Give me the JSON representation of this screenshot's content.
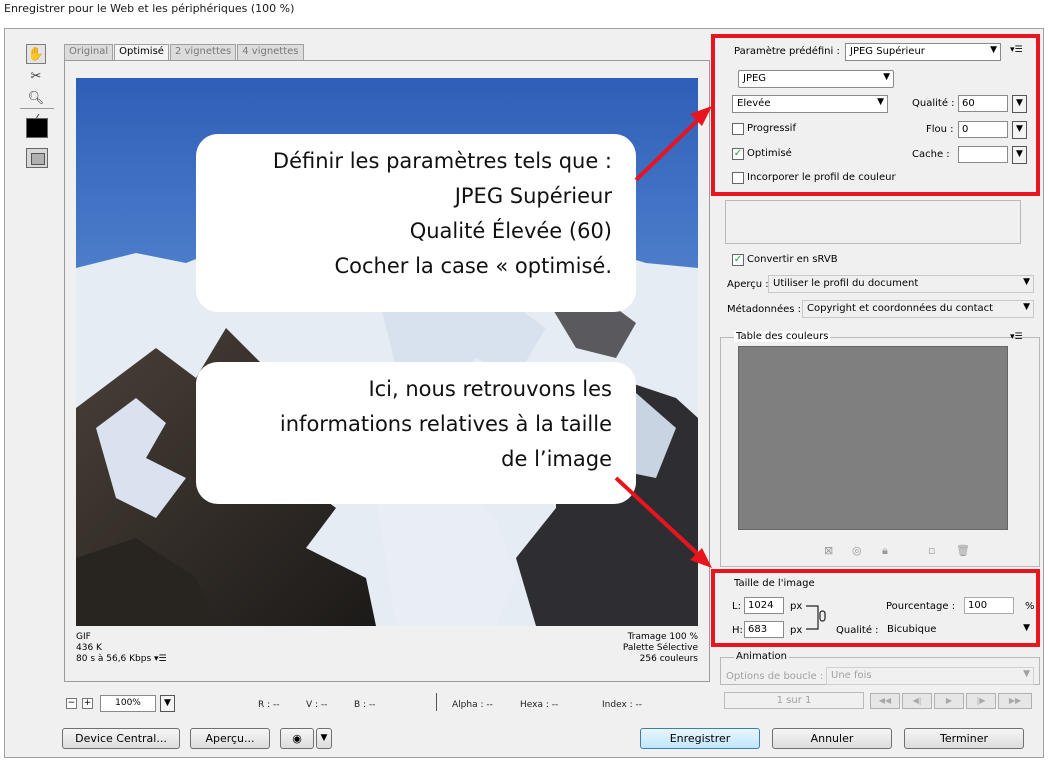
{
  "window": {
    "title": "Enregistrer pour le Web et les périphériques (100 %)"
  },
  "tabs": [
    "Original",
    "Optimisé",
    "2 vignettes",
    "4 vignettes"
  ],
  "active_tab": "Optimisé",
  "preview_info": {
    "format": "GIF",
    "size": "436 K",
    "download": "80 s à 56,6 Kbps",
    "dither": "Tramage 100 %",
    "palette": "Palette Sélective",
    "colors": "256 couleurs"
  },
  "callouts": {
    "settings": [
      "Définir les paramètres tels que :",
      "JPEG Supérieur",
      "Qualité Élevée (60)",
      "Cocher la case « optimisé."
    ],
    "size": [
      "Ici, nous retrouvons les",
      "informations relatives à la taille",
      "de l’image"
    ]
  },
  "settings": {
    "preset_label": "Paramètre prédéfini :",
    "preset_value": "JPEG Supérieur",
    "format": "JPEG",
    "quality_level": "Elevée",
    "quality_label": "Qualité :",
    "quality_value": "60",
    "progressive_label": "Progressif",
    "progressive_checked": false,
    "blur_label": "Flou :",
    "blur_value": "0",
    "optimized_label": "Optimisé",
    "optimized_checked": true,
    "matte_label": "Cache :",
    "matte_value": "",
    "embed_profile_label": "Incorporer le profil de couleur",
    "embed_profile_checked": false,
    "convert_srgb_label": "Convertir en sRVB",
    "convert_srgb_checked": true,
    "preview_label": "Aperçu :",
    "preview_value": "Utiliser le profil du document",
    "metadata_label": "Métadonnées :",
    "metadata_value": "Copyright et coordonnées du contact"
  },
  "color_table": {
    "title": "Table des couleurs"
  },
  "image_size": {
    "title": "Taille de l'image",
    "width_label": "L:",
    "width": "1024",
    "height_label": "H:",
    "height": "683",
    "unit": "px",
    "percent_label": "Pourcentage :",
    "percent": "100",
    "percent_unit": "%",
    "quality_label": "Qualité :",
    "quality": "Bicubique"
  },
  "animation": {
    "title": "Animation",
    "loop_label": "Options de boucle :",
    "loop_value": "Une fois",
    "frame": "1 sur 1"
  },
  "status": {
    "zoom": "100%",
    "r": "R : --",
    "v": "V : --",
    "b": "B : --",
    "alpha": "Alpha : --",
    "hexa": "Hexa : --",
    "index": "Index : --"
  },
  "buttons": {
    "device_central": "Device Central...",
    "preview": "Aperçu...",
    "save": "Enregistrer",
    "cancel": "Annuler",
    "done": "Terminer"
  },
  "colors": {
    "highlight": "#e8141e",
    "sky": "#3a6cc2",
    "table_gray": "#7f7f7f"
  }
}
